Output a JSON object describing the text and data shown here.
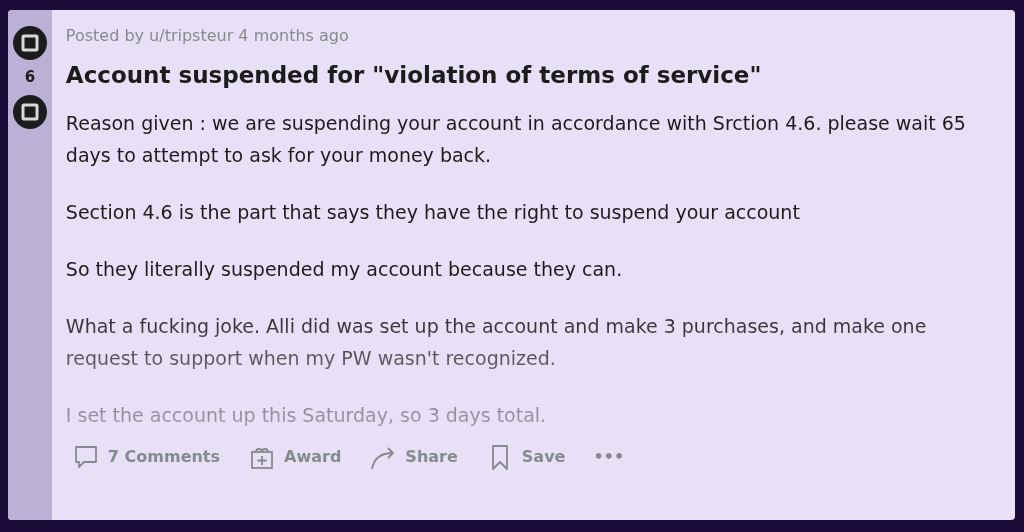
{
  "post": {
    "votes": "6",
    "posted": "Posted by u/tripsteur 4 months ago",
    "title": "Account suspended for \"violation of terms of service\"",
    "paragraphs": [
      "Reason given : we are suspending your account in accordance with Srction 4.6. please wait 65 days to attempt to ask for your money back.",
      "Section 4.6 is the part that says they have the right to suspend your account",
      "So they literally suspended my account because they can.",
      "What a fucking joke. Alli did was set up the account and make 3 purchases, and make one request to support when my PW wasn't recognized.",
      "I set the account up this Saturday, so 3 days total."
    ],
    "actions": [
      {
        "kind": "comments",
        "label": "7 Comments"
      },
      {
        "kind": "award",
        "label": "Award"
      },
      {
        "kind": "share",
        "label": "Share"
      },
      {
        "kind": "save",
        "label": "Save"
      },
      {
        "kind": "more",
        "label": "•••"
      }
    ]
  }
}
